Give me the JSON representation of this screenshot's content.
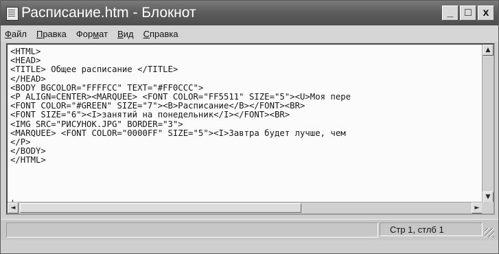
{
  "window": {
    "title": "Расписание.htm - Блокнот",
    "buttons": {
      "minimize": "_",
      "maximize": "□",
      "close": "x"
    }
  },
  "menu": {
    "items": [
      {
        "first": "Ф",
        "rest": "айл"
      },
      {
        "first": "П",
        "rest": "равка"
      },
      {
        "first": "Фор",
        "under": "м",
        "after": "ат"
      },
      {
        "first": "В",
        "rest": "ид"
      },
      {
        "first": "С",
        "rest": "правка"
      }
    ]
  },
  "editor": {
    "lines": [
      "<HTML>",
      "<HEAD>",
      "<TITLE> Общее расписание </TITLE>",
      "</HEAD>",
      "<BODY BGCOLOR=\"FFFFCC\" TEXT=\"#FF0CCC\">",
      "<P ALIGN=CENTER><MARQUEE> <FONT COLOR=\"FF5511\" SIZE=\"5\"><U>Моя пере",
      "<FONT COLOR=\"#GREEN\" SIZE=\"7\"><B>Расписание</B></FONT><BR>",
      "<FONT SIZE=\"6\"><I>занятий на понедельник</I></FONT><BR>",
      "<IMG SRC=\"РИСУНОК.JPG\" BORDER=\"3\">",
      "<MARQUEE> <FONT COLOR=\"0000FF\" SIZE=\"5\"><I>Завтра будет лучше, чем",
      "</P>",
      "</BODY>",
      "</HTML>"
    ]
  },
  "scrollbars": {
    "up": "▲",
    "down": "▼",
    "left": "◄",
    "right": "►"
  },
  "status": {
    "position": "Стр 1, стлб 1"
  }
}
